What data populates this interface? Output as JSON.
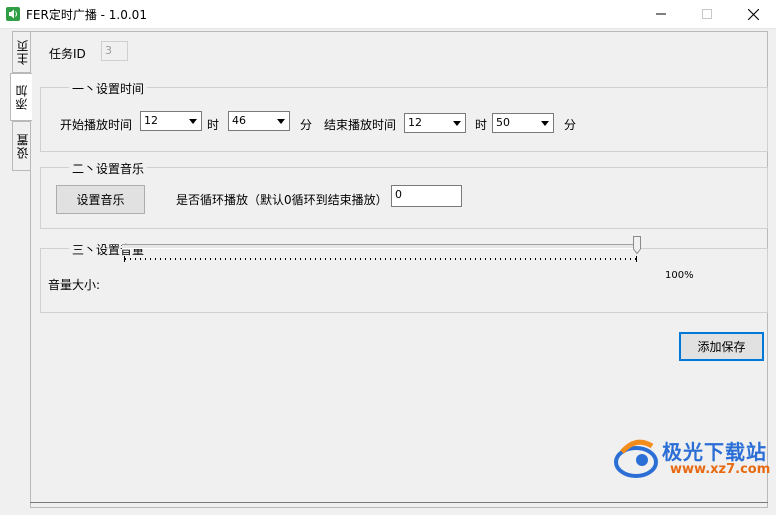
{
  "window": {
    "title": "FER定时广播 - 1.0.01",
    "icon": "speaker-icon",
    "controls": [
      "minimize",
      "maximize",
      "close"
    ]
  },
  "tabs": [
    {
      "label": "主页",
      "active": false
    },
    {
      "label": "添加",
      "active": true
    },
    {
      "label": "设置",
      "active": false
    }
  ],
  "task": {
    "label": "任务ID",
    "value": "3"
  },
  "time_group": {
    "title": "一丶设置时间",
    "start_label": "开始播放时间",
    "start_hour": "12",
    "hour_unit": "时",
    "start_minute": "46",
    "minute_unit": "分",
    "end_label": "结束播放时间",
    "end_hour": "12",
    "end_minute": "50"
  },
  "music_group": {
    "title": "二丶设置音乐",
    "set_music_button": "设置音乐",
    "loop_label": "是否循环播放（默认0循环到结束播放）",
    "loop_value": "0"
  },
  "volume_group": {
    "title": "三丶设置音量",
    "volume_label": "音量大小:",
    "volume_value": "100%",
    "volume_level": 1.0
  },
  "save_button": "添加保存",
  "watermark": {
    "name": "极光下载站",
    "url": "www.xz7.com"
  },
  "colors": {
    "accent": "#0078d7",
    "icon_green": "#2f9e44",
    "watermark_blue": "#2b6fd6",
    "watermark_orange": "#e56a12"
  }
}
